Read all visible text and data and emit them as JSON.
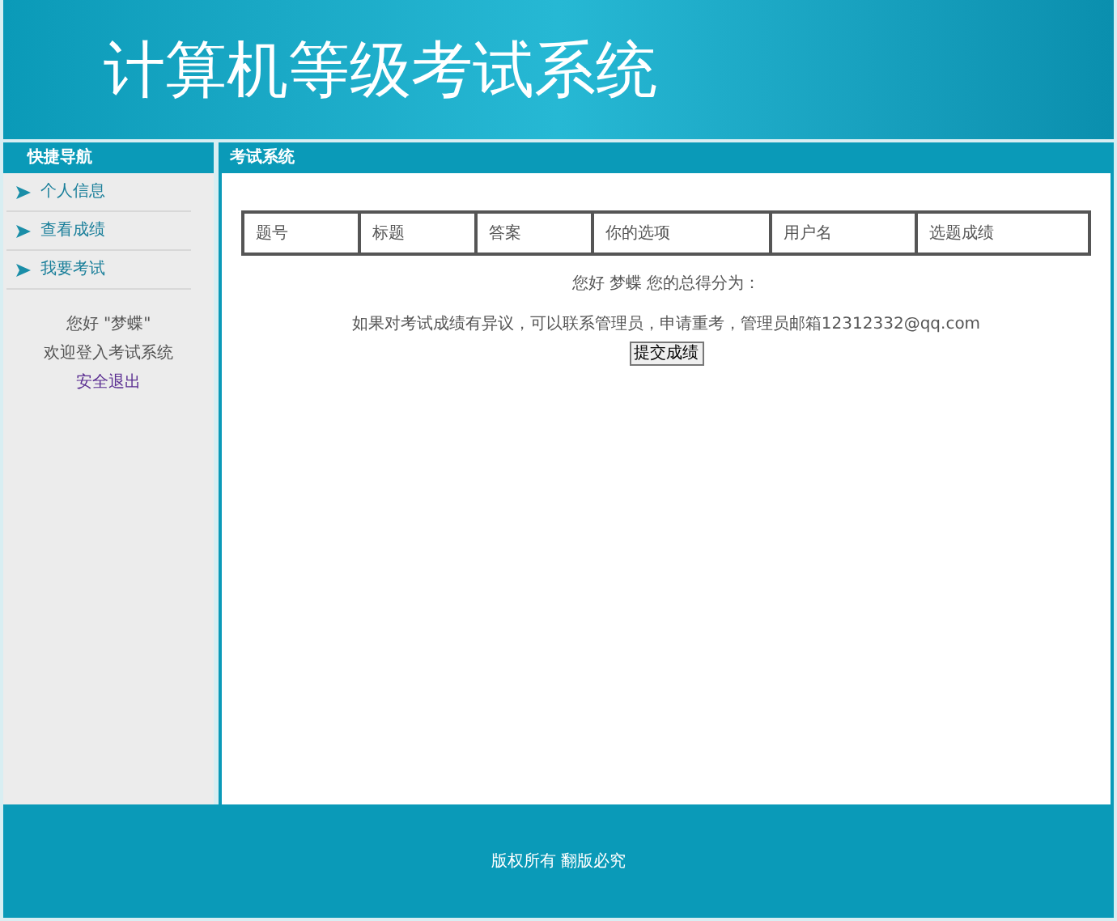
{
  "header": {
    "title": "计算机等级考试系统"
  },
  "sidebar": {
    "title": "快捷导航",
    "items": [
      {
        "label": "个人信息"
      },
      {
        "label": "查看成绩"
      },
      {
        "label": "我要考试"
      }
    ],
    "greeting": "您好 \"梦蝶\"",
    "welcome": "欢迎登入考试系统",
    "logout": "安全退出"
  },
  "main": {
    "title": "考试系统",
    "table": {
      "columns": [
        "题号",
        "标题",
        "答案",
        "你的选项",
        "用户名",
        "选题成绩"
      ]
    },
    "score_line": "您好 梦蝶 您的总得分为：",
    "notice": "如果对考试成绩有异议，可以联系管理员，申请重考，管理员邮箱12312332@qq.com",
    "submit_button": "提交成绩"
  },
  "footer": {
    "text": "版权所有 翻版必究"
  }
}
